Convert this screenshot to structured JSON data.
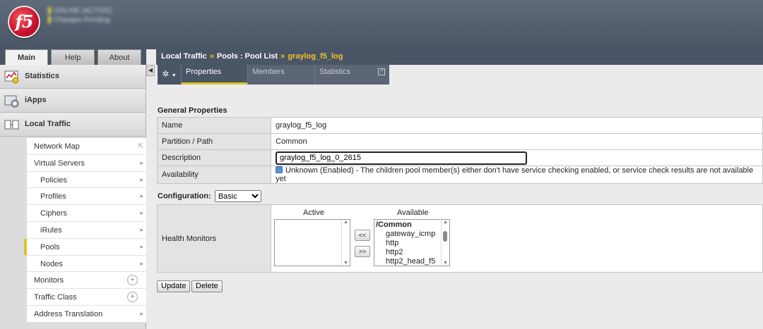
{
  "banner": {
    "logo_text": "f5",
    "status_lines": [
      "ONLINE (ACTIVE)",
      "Changes Pending"
    ]
  },
  "left_tabs": [
    {
      "label": "Main",
      "active": true
    },
    {
      "label": "Help",
      "active": false
    },
    {
      "label": "About",
      "active": false
    }
  ],
  "sidebar": {
    "sections": [
      {
        "label": "Statistics",
        "icon": "statistics-chart-icon"
      },
      {
        "label": "iApps",
        "icon": "iapps-gear-icon"
      },
      {
        "label": "Local Traffic",
        "icon": "local-traffic-icon"
      }
    ],
    "items": [
      {
        "label": "Network Map",
        "indent": false,
        "marker": "popout"
      },
      {
        "label": "Virtual Servers",
        "indent": false,
        "marker": "arrow"
      },
      {
        "label": "Policies",
        "indent": true,
        "marker": "arrow"
      },
      {
        "label": "Profiles",
        "indent": true,
        "marker": "arrow"
      },
      {
        "label": "Ciphers",
        "indent": true,
        "marker": "arrow"
      },
      {
        "label": "iRules",
        "indent": true,
        "marker": "arrow"
      },
      {
        "label": "Pools",
        "indent": true,
        "marker": "arrow",
        "selected": true
      },
      {
        "label": "Nodes",
        "indent": true,
        "marker": "arrow"
      },
      {
        "label": "Monitors",
        "indent": false,
        "marker": "plus"
      },
      {
        "label": "Traffic Class",
        "indent": false,
        "marker": "plus"
      },
      {
        "label": "Address Translation",
        "indent": false,
        "marker": "arrow"
      }
    ]
  },
  "breadcrumb": {
    "part1": "Local Traffic",
    "sep1": "»",
    "part2": "Pools : Pool List",
    "sep2": "»",
    "current": "graylog_f5_log"
  },
  "content_tabs": [
    {
      "label": "Properties",
      "active": true
    },
    {
      "label": "Members",
      "active": false
    },
    {
      "label": "Statistics",
      "active": false
    }
  ],
  "general": {
    "heading": "General Properties",
    "name_label": "Name",
    "name_value": "graylog_f5_log",
    "partition_label": "Partition / Path",
    "partition_value": "Common",
    "description_label": "Description",
    "description_value": "graylog_f5_log_0_2615",
    "availability_label": "Availability",
    "availability_value": "Unknown (Enabled) - The children pool member(s) either don't have service checking enabled, or service check results are not available yet"
  },
  "configuration": {
    "label": "Configuration:",
    "selected": "Basic"
  },
  "health_monitors": {
    "label": "Health Monitors",
    "active_label": "Active",
    "available_label": "Available",
    "active_items": [],
    "available_group": "/Common",
    "available_items": [
      "gateway_icmp",
      "http",
      "http2",
      "http2_head_f5"
    ],
    "move_left": "<<",
    "move_right": ">>"
  },
  "buttons": {
    "update": "Update",
    "delete": "Delete"
  }
}
